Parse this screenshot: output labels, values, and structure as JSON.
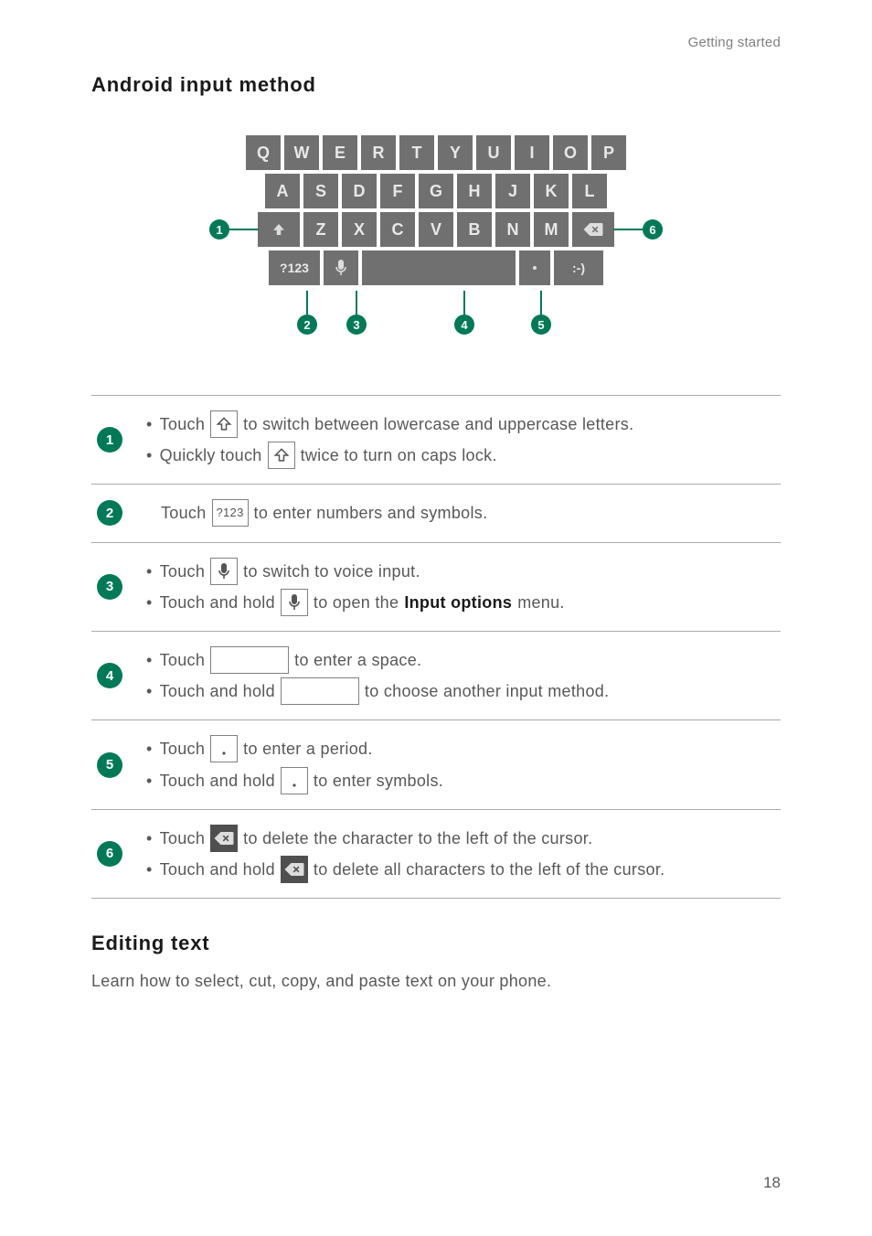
{
  "header_label": "Getting started",
  "section1_title": "Android input method",
  "keyboard": {
    "row1": [
      "Q",
      "W",
      "E",
      "R",
      "T",
      "Y",
      "U",
      "I",
      "O",
      "P"
    ],
    "row2": [
      "A",
      "S",
      "D",
      "F",
      "G",
      "H",
      "J",
      "K",
      "L"
    ],
    "row3_mid": [
      "Z",
      "X",
      "C",
      "V",
      "B",
      "N",
      "M"
    ],
    "symkey": "?123",
    "smile": ":-)"
  },
  "callouts": {
    "c1": "1",
    "c2": "2",
    "c3": "3",
    "c4": "4",
    "c5": "5",
    "c6": "6"
  },
  "rows": {
    "r1": {
      "num": "1",
      "a_before": "Touch",
      "a_after": "to switch between lowercase and uppercase letters.",
      "b_before": "Quickly touch",
      "b_after": "twice to turn on caps lock."
    },
    "r2": {
      "num": "2",
      "before": "Touch",
      "after": "to enter numbers and symbols.",
      "icon_text": "?123"
    },
    "r3": {
      "num": "3",
      "a_before": "Touch",
      "a_after": "to switch to voice input.",
      "b_before": "Touch and hold",
      "b_mid": "to open the",
      "b_bold": "Input options",
      "b_after": "menu."
    },
    "r4": {
      "num": "4",
      "a_before": "Touch",
      "a_after": "to enter a space.",
      "b_before": "Touch and hold",
      "b_after": "to choose another input method."
    },
    "r5": {
      "num": "5",
      "a_before": "Touch",
      "a_after": "to enter a period.",
      "b_before": "Touch and hold",
      "b_after": "to enter symbols."
    },
    "r6": {
      "num": "6",
      "a_before": "Touch",
      "a_after": "to delete the character to the left of the cursor.",
      "b_before": "Touch and hold",
      "b_after": "to delete all characters to the left of the cursor."
    }
  },
  "section2_title": "Editing text",
  "section2_desc": "Learn how to select, cut, copy, and paste text on your phone.",
  "page_number": "18"
}
